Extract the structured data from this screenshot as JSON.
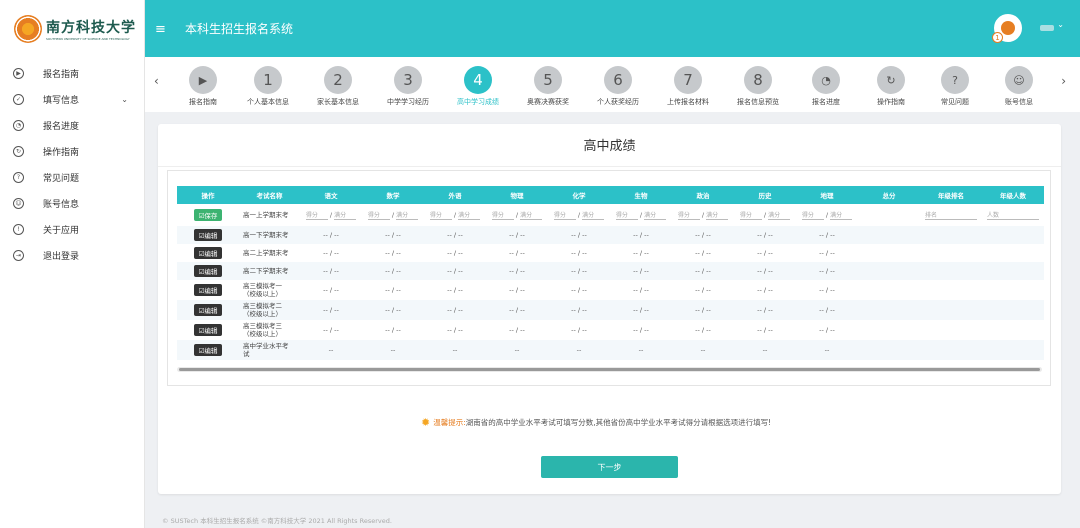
{
  "app": {
    "title": "本科生招生报名系统",
    "logo_cn": "南方科技大学",
    "logo_en": "SOUTHERN UNIVERSITY OF SCIENCE AND TECHNOLOGY",
    "footer": "© SUSTech 本科生招生报名系统 ©南方科技大学 2021 All Rights Reserved."
  },
  "colors": {
    "primary": "#2cc1c8",
    "save": "#3cb371",
    "edit": "#333333",
    "next": "#2bb5ac"
  },
  "header": {
    "menu_icon": "≡",
    "user_badge": "1",
    "user_caret": "⌄"
  },
  "sidebar": {
    "items": [
      {
        "label": "报名指南",
        "icon": "▶"
      },
      {
        "label": "填写信息",
        "icon": "✓",
        "chevron": "⌄"
      },
      {
        "label": "报名进度",
        "icon": "◔"
      },
      {
        "label": "操作指南",
        "icon": "↻"
      },
      {
        "label": "常见问题",
        "icon": "?"
      },
      {
        "label": "账号信息",
        "icon": "☺"
      },
      {
        "label": "关于应用",
        "icon": "!"
      },
      {
        "label": "退出登录",
        "icon": "⇥"
      }
    ]
  },
  "steps": {
    "prev": "‹",
    "next": "›",
    "items": [
      {
        "mark": "▶",
        "label": "报名指南"
      },
      {
        "mark": "1",
        "label": "个人基本信息"
      },
      {
        "mark": "2",
        "label": "家长基本信息"
      },
      {
        "mark": "3",
        "label": "中学学习经历"
      },
      {
        "mark": "4",
        "label": "高中学习成绩"
      },
      {
        "mark": "5",
        "label": "奥赛决赛获奖"
      },
      {
        "mark": "6",
        "label": "个人获奖经历"
      },
      {
        "mark": "7",
        "label": "上传报名材料"
      },
      {
        "mark": "8",
        "label": "报名信息预览"
      },
      {
        "mark": "◔",
        "label": "报名进度"
      },
      {
        "mark": "↻",
        "label": "操作指南"
      },
      {
        "mark": "?",
        "label": "常见问题"
      },
      {
        "mark": "☺",
        "label": "账号信息"
      }
    ]
  },
  "main": {
    "title": "高中成绩",
    "columns": [
      "操作",
      "考试名称",
      "语文",
      "数学",
      "外语",
      "物理",
      "化学",
      "生物",
      "政治",
      "历史",
      "地理",
      "总分",
      "年级排名",
      "年级人数"
    ],
    "save_label": "☑保存",
    "edit_label": "☑编辑",
    "score_placeholder": "得分",
    "full_placeholder": "满分",
    "rank_placeholder": "排名",
    "count_placeholder": "人数",
    "empty_score": "-- / --",
    "empty_simple": "--",
    "rows": [
      {
        "exam": "高一上学期末考"
      },
      {
        "exam": "高一下学期末考"
      },
      {
        "exam": "高二上学期末考"
      },
      {
        "exam": "高二下学期末考"
      },
      {
        "exam": "高三模拟考一\n（校级以上）"
      },
      {
        "exam": "高三模拟考二\n（校级以上）"
      },
      {
        "exam": "高三模拟考三\n（校级以上）"
      },
      {
        "exam": "高中学业水平考\n试"
      }
    ],
    "tip_label": "温馨提示:",
    "tip_text": "湖南省的高中学业水平考试可填写分数,其他省份高中学业水平考试得分请根据选项进行填写!",
    "next_button": "下一步"
  }
}
